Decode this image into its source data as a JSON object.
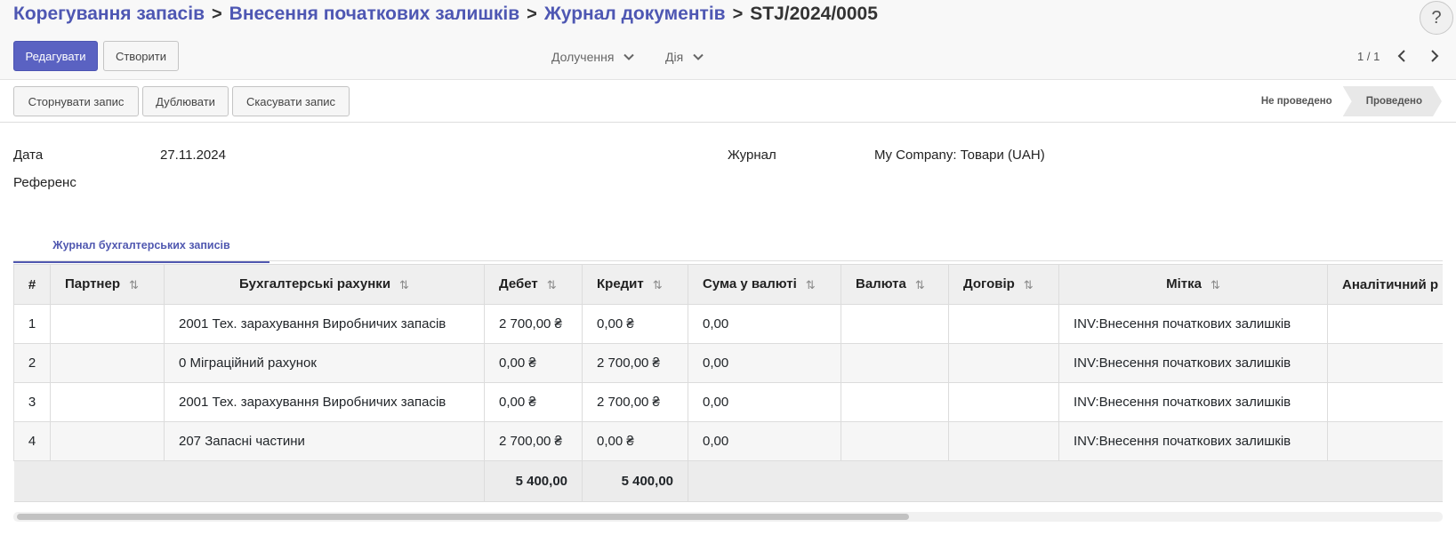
{
  "breadcrumb": {
    "items": [
      "Корегування запасів",
      "Внесення початкових залишків",
      "Журнал документів"
    ],
    "current": "STJ/2024/0005",
    "separator": ">"
  },
  "help_label": "?",
  "toolbar": {
    "edit_label": "Редагувати",
    "create_label": "Створити",
    "attachments_label": "Долучення",
    "action_label": "Дія",
    "pager": "1 / 1"
  },
  "statusbar": {
    "reverse_label": "Сторнувати запис",
    "duplicate_label": "Дублювати",
    "cancel_label": "Скасувати запис",
    "stages": [
      "Не проведено",
      "Проведено"
    ]
  },
  "form": {
    "date_label": "Дата",
    "date_value": "27.11.2024",
    "reference_label": "Референс",
    "journal_label": "Журнал",
    "journal_value": "My Company: Товари (UAH)"
  },
  "tab_label": "Журнал бухгалтерських записів",
  "table": {
    "columns": [
      "#",
      "Партнер",
      "Бухгалтерські рахунки",
      "Дебет",
      "Кредит",
      "Сума у валюті",
      "Валюта",
      "Договір",
      "Мітка",
      "Аналітичний р"
    ],
    "rows": [
      [
        "1",
        "",
        "2001 Тех. зарахування Виробничих запасів",
        "2 700,00 ₴",
        "0,00 ₴",
        "0,00",
        "",
        "",
        "INV:Внесення початкових залишків",
        ""
      ],
      [
        "2",
        "",
        "0 Міграційний рахунок",
        "0,00 ₴",
        "2 700,00 ₴",
        "0,00",
        "",
        "",
        "INV:Внесення початкових залишків",
        ""
      ],
      [
        "3",
        "",
        "2001 Тех. зарахування Виробничих запасів",
        "0,00 ₴",
        "2 700,00 ₴",
        "0,00",
        "",
        "",
        "INV:Внесення початкових залишків",
        ""
      ],
      [
        "4",
        "",
        "207 Запасні частини",
        "2 700,00 ₴",
        "0,00 ₴",
        "0,00",
        "",
        "",
        "INV:Внесення початкових залишків",
        ""
      ]
    ],
    "totals": {
      "debit": "5 400,00",
      "credit": "5 400,00"
    }
  },
  "colors": {
    "accent": "#5a62c2",
    "link": "#4e57b3"
  }
}
